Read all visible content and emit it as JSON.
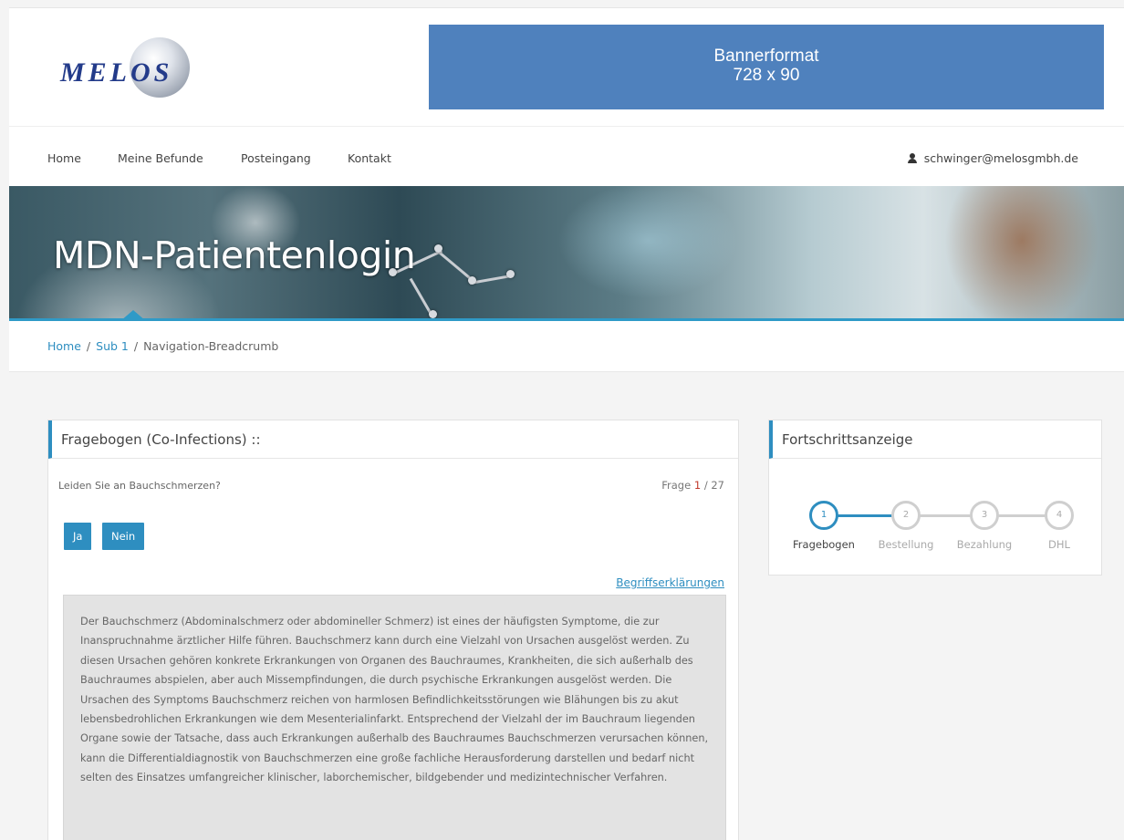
{
  "header": {
    "logo_text": "MELOS",
    "banner_line1": "Bannerformat",
    "banner_line2": "728 x 90"
  },
  "nav": {
    "items": [
      "Home",
      "Meine Befunde",
      "Posteingang",
      "Kontakt"
    ],
    "user_email": "schwinger@melosgmbh.de",
    "user_icon": "user-icon"
  },
  "hero": {
    "title": "MDN-Patientenlogin"
  },
  "breadcrumb": {
    "items": [
      "Home",
      "Sub 1",
      "Navigation-Breadcrumb"
    ],
    "separator": "/"
  },
  "questionnaire": {
    "title": "Fragebogen (Co-Infections) ::",
    "question": "Leiden Sie an Bauchschmerzen?",
    "counter_prefix": "Frage ",
    "counter_current": "1",
    "counter_total": " / 27",
    "yes_label": "Ja",
    "no_label": "Nein",
    "terms_link": "Begriffserklärungen",
    "explanation": "Der Bauchschmerz (Abdominalschmerz oder abdomineller Schmerz) ist eines der häufigsten Symptome, die zur Inanspruchnahme ärztlicher Hilfe führen. Bauchschmerz kann durch eine Vielzahl von Ursachen ausgelöst werden. Zu diesen Ursachen gehören konkrete Erkrankungen von Organen des Bauchraumes, Krankheiten, die sich außerhalb des Bauchraumes abspielen, aber auch Missempfindungen, die durch psychische Erkrankungen ausgelöst werden. Die Ursachen des Symptoms Bauchschmerz reichen von harmlosen Befindlichkeitsstörungen wie Blähungen bis zu akut lebensbedrohlichen Erkrankungen wie dem Mesenterialinfarkt. Entsprechend der Vielzahl der im Bauchraum liegenden Organe sowie der Tatsache, dass auch Erkrankungen außerhalb des Bauchraumes Bauchschmerzen verursachen können, kann die Differentialdiagnostik von Bauchschmerzen eine große fachliche Herausforderung darstellen und bedarf nicht selten des Einsatzes umfangreicher klinischer, laborchemischer, bildgebender und medizintechnischer Verfahren."
  },
  "progress": {
    "title": "Fortschrittsanzeige",
    "steps": [
      {
        "num": "1",
        "label": "Fragebogen"
      },
      {
        "num": "2",
        "label": "Bestellung"
      },
      {
        "num": "3",
        "label": "Bezahlung"
      },
      {
        "num": "4",
        "label": "DHL"
      }
    ],
    "current_step": 1
  },
  "colors": {
    "accent": "#2e8ec0",
    "banner": "#4f81bd",
    "logo": "#233b8a",
    "counter_highlight": "#c0392b"
  }
}
